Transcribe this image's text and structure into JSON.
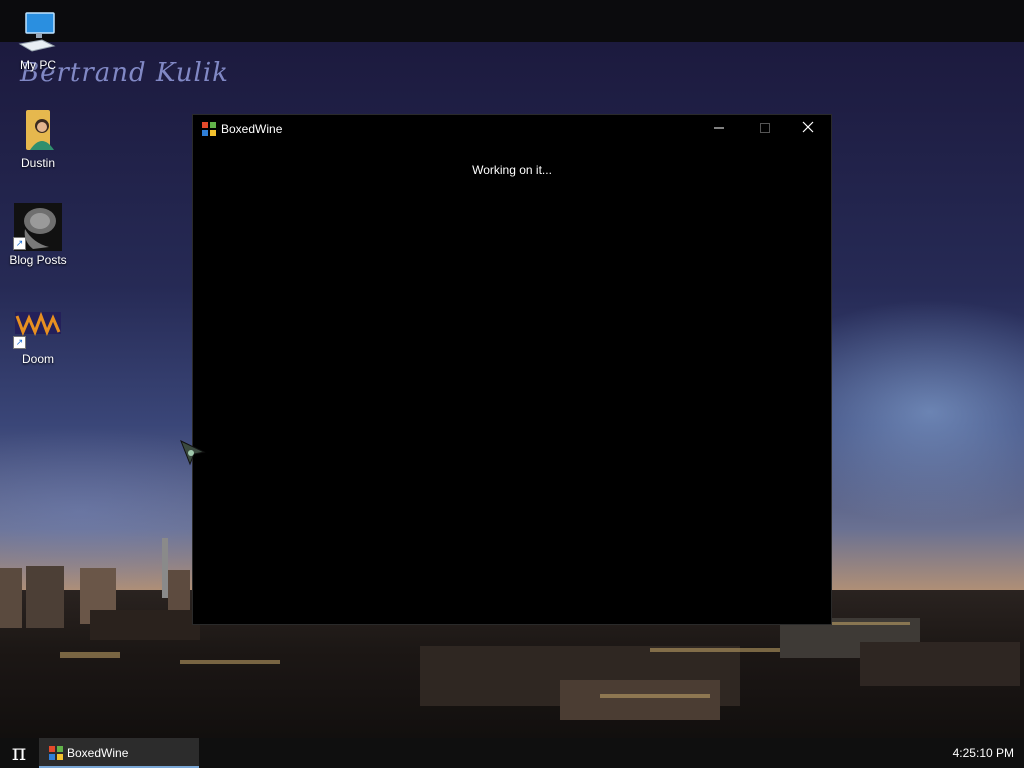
{
  "desktop": {
    "signature": "Bertrand Kulik",
    "icons": [
      {
        "label": "My PC",
        "icon": "computer-icon"
      },
      {
        "label": "Dustin",
        "icon": "user-folder-icon"
      },
      {
        "label": "Blog Posts",
        "icon": "brain-scan-shortcut-icon"
      },
      {
        "label": "Doom",
        "icon": "doom-shortcut-icon"
      }
    ]
  },
  "window": {
    "title": "BoxedWine",
    "status": "Working on it...",
    "icon": "windows-flag-icon"
  },
  "taskbar": {
    "start_glyph": "π",
    "item_label": "BoxedWine",
    "clock": "4:25:10 PM",
    "accent": "#7aa7d6"
  }
}
